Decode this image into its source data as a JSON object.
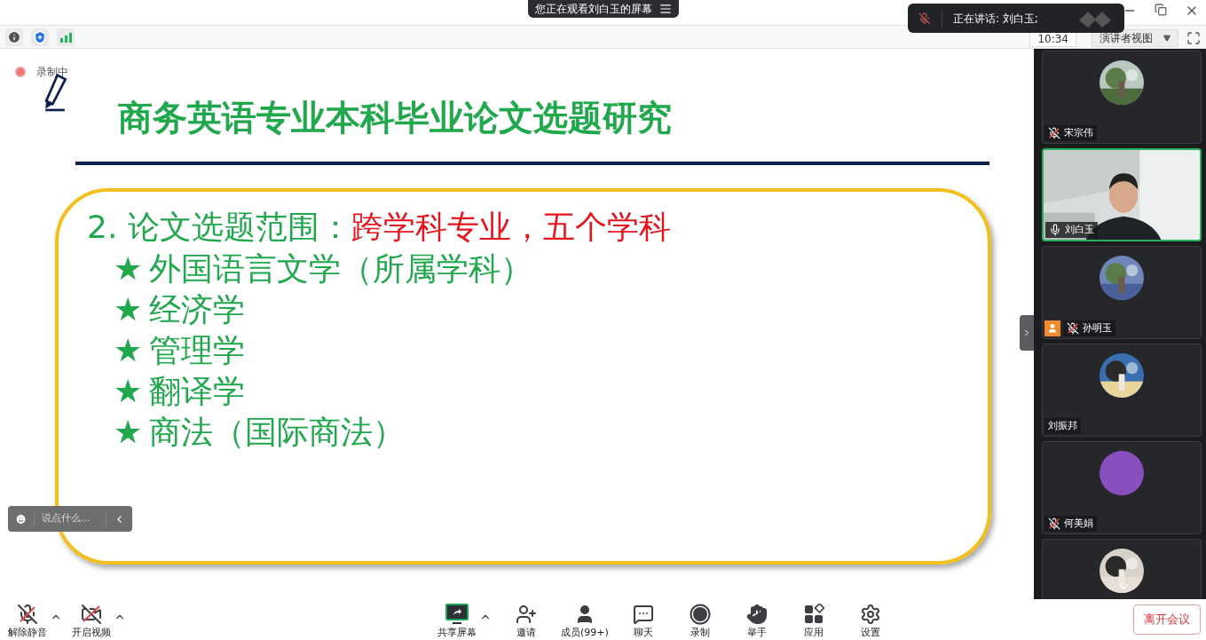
{
  "window": {
    "banner": "您正在观看刘白玉的屏幕"
  },
  "toolbar": {
    "time": "10:34",
    "view": "演讲者视图"
  },
  "speaking_notice": {
    "text": "正在讲话: 刘白玉;"
  },
  "recording": {
    "on": true,
    "label": "录制中"
  },
  "slide": {
    "title": "商务英语专业本科毕业论文选题研究",
    "heading": {
      "lead": "2. 论文选题范围：",
      "highlight": "跨学科专业，五个学科"
    },
    "items": [
      {
        "bullet": "★",
        "text": "外国语言文学（所属学科）"
      },
      {
        "bullet": "★",
        "text": "经济学"
      },
      {
        "bullet": "★",
        "text": "管理学"
      },
      {
        "bullet": "★",
        "text": "翻译学"
      },
      {
        "bullet": "★",
        "text": "商法（国际商法）"
      }
    ]
  },
  "chat_input": {
    "placeholder": "说点什么..."
  },
  "participants": [
    {
      "name": "宋宗伟",
      "mic_muted": true,
      "speaking": false,
      "host": false,
      "kind": "picture"
    },
    {
      "name": "刘白玉",
      "mic_muted": false,
      "speaking": true,
      "host": false,
      "kind": "video"
    },
    {
      "name": "孙明玉",
      "mic_muted": true,
      "speaking": false,
      "host": true,
      "kind": "picture"
    },
    {
      "name": "刘振邦",
      "speaking": false,
      "host": false,
      "kind": "picture"
    },
    {
      "name": "何美娟",
      "mic_muted": true,
      "speaking": false,
      "host": false,
      "kind": "avatar",
      "color": "#8a4fbf"
    },
    {
      "kind": "picture",
      "speaking": false
    }
  ],
  "controls": [
    {
      "kind": "mic",
      "label": "解除静音",
      "has_menu": true
    },
    {
      "kind": "video",
      "label": "开启视频",
      "has_menu": true
    },
    {
      "kind": "share",
      "label": "共享屏幕",
      "has_menu": true
    },
    {
      "kind": "invite",
      "label": "邀请",
      "has_menu": false
    },
    {
      "kind": "members",
      "label": "成员(99+)",
      "has_menu": false
    },
    {
      "kind": "chat",
      "label": "聊天",
      "has_menu": false
    },
    {
      "kind": "record",
      "label": "录制",
      "has_menu": false
    },
    {
      "kind": "hand",
      "label": "举手",
      "has_menu": false
    },
    {
      "kind": "apps",
      "label": "应用",
      "has_menu": false
    },
    {
      "kind": "settings",
      "label": "设置",
      "has_menu": false
    }
  ],
  "leave_button": "离开会议"
}
